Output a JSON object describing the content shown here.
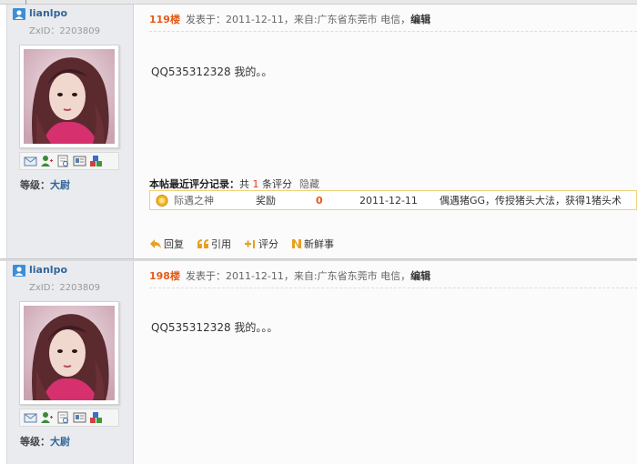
{
  "colors": {
    "floor": "#e55b1a",
    "username": "#336699",
    "rating_border": "#f0d27a",
    "sidebar_bg": "#e9ebee"
  },
  "posts": [
    {
      "author": {
        "username": "lianlpo",
        "zxid": "ZxID：2203809",
        "avatar_icons": [
          "message-icon",
          "add-friend-icon",
          "profile-icon",
          "card-icon",
          "blocks-icon"
        ],
        "level_label": "等级：",
        "level_value": "大尉"
      },
      "floor": "119楼",
      "meta_text": "发表于：2011-12-11，来自:广东省东莞市 电信，",
      "edit_label": "编辑",
      "content": "QQ535312328 我的。。",
      "rating": {
        "title": "本帖最近评分记录：",
        "count_prefix": "共 ",
        "count": "1",
        "count_suffix": " 条评分",
        "hide_label": "隐藏",
        "rows": [
          {
            "user": "际遇之神",
            "type": "奖励",
            "score": "0",
            "date": "2011-12-11",
            "reason": "偶遇猪GG，传授猪头大法，获得1猪头术"
          }
        ]
      },
      "actions": {
        "reply": "回复",
        "quote": "引用",
        "rate": "评分",
        "news": "新鲜事"
      }
    },
    {
      "author": {
        "username": "lianlpo",
        "zxid": "ZxID：2203809",
        "avatar_icons": [
          "message-icon",
          "add-friend-icon",
          "profile-icon",
          "card-icon",
          "blocks-icon"
        ],
        "level_label": "等级：",
        "level_value": "大尉"
      },
      "floor": "198楼",
      "meta_text": "发表于：2011-12-11，来自:广东省东莞市 电信，",
      "edit_label": "编辑",
      "content": "QQ535312328 我的。。。"
    }
  ]
}
